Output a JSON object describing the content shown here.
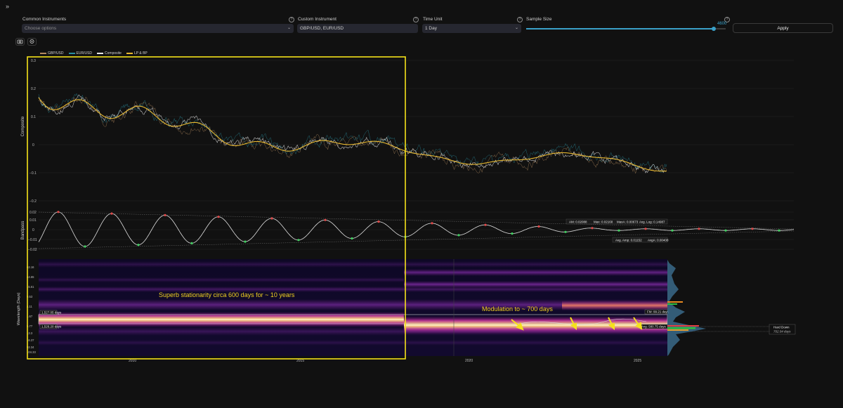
{
  "toolbar": {
    "expand_glyph": "»",
    "common_instruments": {
      "label": "Common Instruments",
      "placeholder": "Choose options"
    },
    "custom_instrument": {
      "label": "Custom Instrument",
      "value": "GBP/USD, EUR/USD"
    },
    "time_unit": {
      "label": "Time Unit",
      "value": "1 Day"
    },
    "sample_size": {
      "label": "Sample Size",
      "value": "4600",
      "fraction": 0.94
    },
    "apply_label": "Apply",
    "help_glyph": "?",
    "chevron_glyph": "⌄",
    "icons": [
      "camera-icon",
      "settings-icon"
    ]
  },
  "legend": [
    {
      "name": "GBP/USD",
      "color": "#b58b60"
    },
    {
      "name": "EUR/USD",
      "color": "#2a8fa0"
    },
    {
      "name": "Composite",
      "color": "#e8e8e8"
    },
    {
      "name": "LP & BP",
      "color": "#e8b830"
    }
  ],
  "main_chart": {
    "ylabel": "Composite",
    "ticks": [
      "0.3",
      "0.2",
      "0.1",
      "0",
      "−0.1",
      "−0.2"
    ]
  },
  "bandpass_chart": {
    "ylabel": "Bandpass",
    "ticks": [
      "0.02",
      "0.01",
      "0",
      "−0.01",
      "−0.02"
    ],
    "stats": {
      "am": "AM: 0.02088",
      "max": "Max: 0.02168",
      "maxm": "MaxA: 0.00673",
      "avg_log": "Avg. Log: 0.14987",
      "avg_amp": "Avg. Amp: 0.01152",
      "avg_a": "AvgA: 0.00408"
    }
  },
  "spectrum_chart": {
    "ylabel": "Wavelength (Days)",
    "ticks": [
      "62.16",
      "44.65",
      "15.61",
      "9.53",
      "4.11",
      "1.67",
      "5.77",
      "13.3",
      "16.37",
      "92.34",
      "104.33"
    ],
    "labels": {
      "peak1": "1,527.05 days",
      "peak2": "1,526.20 days",
      "fm": "FM: 99.21 days",
      "avg": "Avg: 580.75 days",
      "hard_down": "Hard Down",
      "hard_down_days": "702.04 days"
    }
  },
  "annotations": {
    "stationarity": "Superb stationarity circa 600 days for ~ 10 years",
    "modulation": "Modulation to ~ 700 days"
  },
  "x_axis": [
    "2010",
    "2015",
    "2020",
    "2025"
  ]
}
